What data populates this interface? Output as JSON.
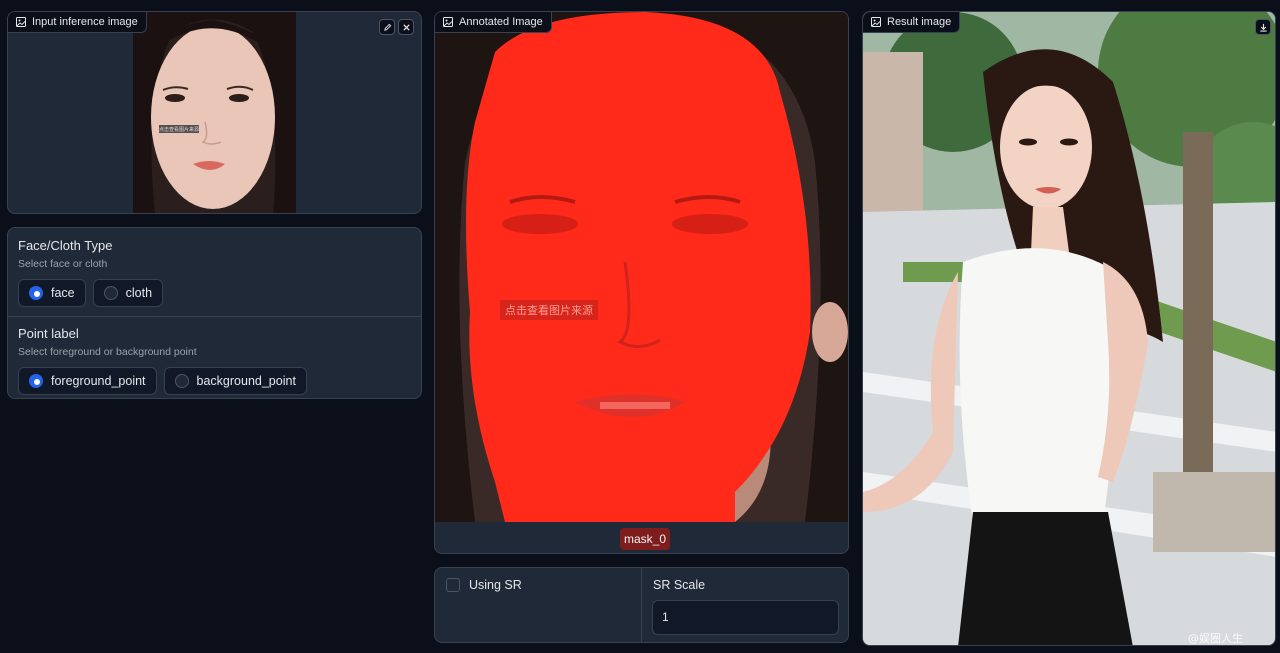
{
  "input_panel": {
    "label": "Input inference image",
    "watermark_text": "点击查看图片来源"
  },
  "type_group": {
    "title": "Face/Cloth Type",
    "subtitle": "Select face or cloth",
    "options": [
      {
        "label": "face",
        "selected": true
      },
      {
        "label": "cloth",
        "selected": false
      }
    ]
  },
  "point_group": {
    "title": "Point label",
    "subtitle": "Select foreground or background point",
    "options": [
      {
        "label": "foreground_point",
        "selected": true
      },
      {
        "label": "background_point",
        "selected": false
      }
    ]
  },
  "annotated_panel": {
    "label": "Annotated Image",
    "watermark_text": "点击查看图片来源",
    "mask_label": "mask_0",
    "mask_color": "#ff2a1a"
  },
  "sr": {
    "checkbox_label": "Using SR",
    "checked": false,
    "scale_label": "SR Scale",
    "scale_value": "1"
  },
  "result_panel": {
    "label": "Result image",
    "watermark_text": "@娱圈人生"
  },
  "colors": {
    "background": "#0b0f19",
    "panel": "#1f2937",
    "border": "#374151",
    "accent": "#2563eb"
  }
}
